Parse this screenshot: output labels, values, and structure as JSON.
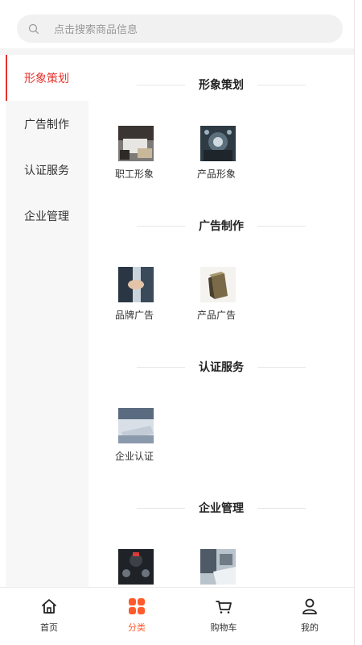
{
  "search": {
    "placeholder": "点击搜索商品信息"
  },
  "sidebar": {
    "items": [
      {
        "label": "形象策划",
        "active": true
      },
      {
        "label": "广告制作",
        "active": false
      },
      {
        "label": "认证服务",
        "active": false
      },
      {
        "label": "企业管理",
        "active": false
      }
    ]
  },
  "sections": [
    {
      "title": "形象策划",
      "products": [
        {
          "label": "职工形象",
          "icon": "office-workspace-photo"
        },
        {
          "label": "产品形象",
          "icon": "business-tech-photo"
        }
      ]
    },
    {
      "title": "广告制作",
      "products": [
        {
          "label": "品牌广告",
          "icon": "handshake-photo"
        },
        {
          "label": "产品广告",
          "icon": "product-box-photo"
        }
      ]
    },
    {
      "title": "认证服务",
      "products": [
        {
          "label": "企业认证",
          "icon": "laptop-typing-photo"
        }
      ]
    },
    {
      "title": "企业管理",
      "products": [
        {
          "label": "",
          "icon": "management-diagram-photo"
        },
        {
          "label": "",
          "icon": "meeting-documents-photo"
        }
      ]
    }
  ],
  "tabbar": {
    "items": [
      {
        "label": "首页",
        "icon": "home-icon",
        "active": false
      },
      {
        "label": "分类",
        "icon": "category-grid-icon",
        "active": true
      },
      {
        "label": "购物车",
        "icon": "cart-icon",
        "active": false
      },
      {
        "label": "我的",
        "icon": "user-icon",
        "active": false
      }
    ]
  },
  "colors": {
    "accent_red": "#e5322d",
    "tab_active": "#ff5a2c",
    "sidebar_bg": "#f7f7f7",
    "search_bg": "#f1f1f1"
  }
}
